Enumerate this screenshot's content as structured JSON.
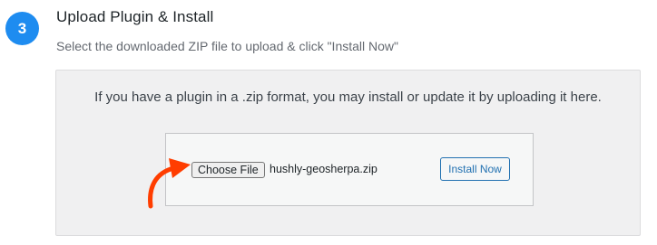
{
  "step": {
    "number": "3",
    "title": "Upload Plugin & Install",
    "subtitle": "Select the downloaded ZIP file to upload & click \"Install Now\""
  },
  "upload": {
    "help_text": "If you have a plugin in a .zip format, you may install or update it by uploading it here.",
    "choose_file_label": "Choose File",
    "selected_file": "hushly-geosherpa.zip",
    "install_label": "Install Now"
  },
  "colors": {
    "badge": "#1e8cf0",
    "accent_button": "#2271b1",
    "arrow": "#ff3d00"
  },
  "icons": {
    "pointer": "curved-arrow-icon"
  }
}
